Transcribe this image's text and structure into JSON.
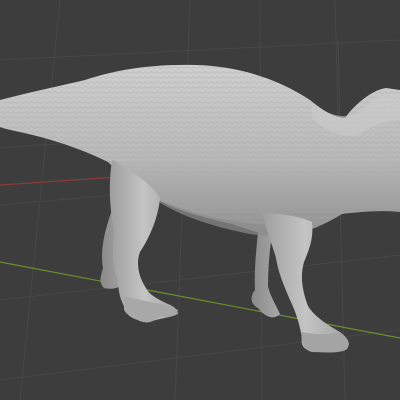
{
  "viewport": {
    "mode": "3d-viewport",
    "background_color": "#3d3d3d",
    "grid_color": "#474747",
    "x_axis_color": "#8b3a3a",
    "y_axis_color": "#6a8f2a",
    "z_axis_color": "#3f5a8a"
  },
  "model": {
    "name": "dinosaur-sculpt",
    "shading": "solid",
    "base_color": "#b9b9b9",
    "shadow_color": "#8a8a8a",
    "highlight_color": "#d6d6d6"
  }
}
